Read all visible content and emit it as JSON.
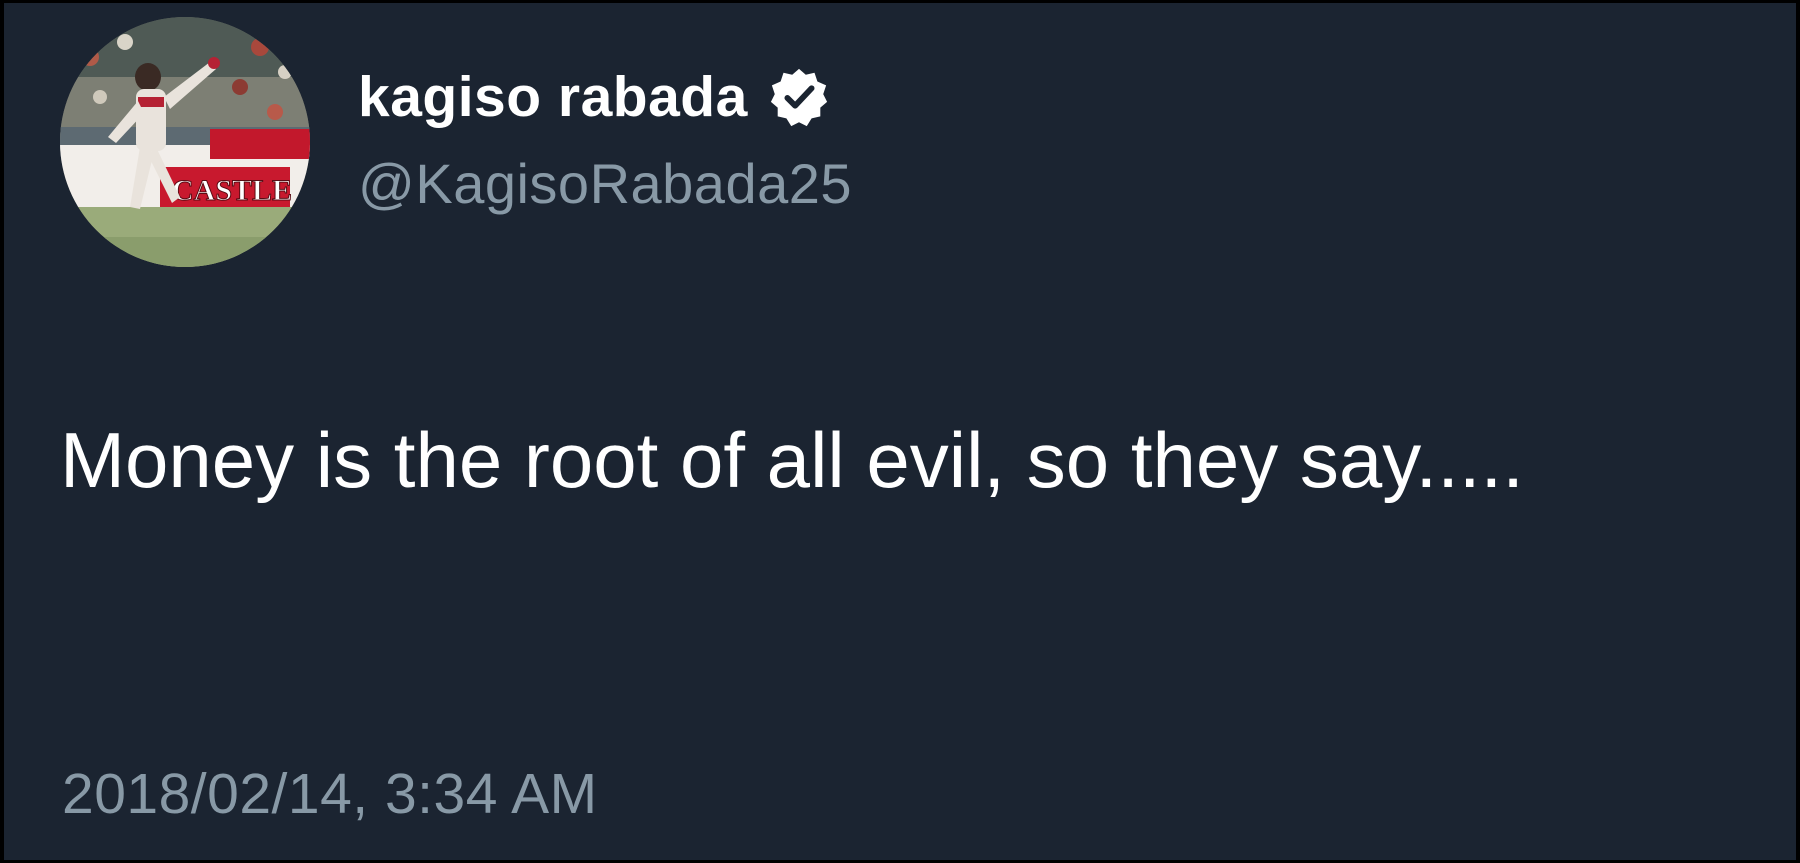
{
  "tweet": {
    "author": {
      "display_name": "kagiso rabada",
      "handle": "@KagisoRabada25",
      "verified": true,
      "avatar_icon": "profile-photo-cricket-bowler",
      "avatar_banner_text": "CASTLE"
    },
    "text": "Money is the root of all evil, so they say.....",
    "timestamp": "2018/02/14, 3:34 AM"
  },
  "colors": {
    "background": "#1b2431",
    "outer_border": "#000000",
    "primary_text": "#ffffff",
    "secondary_text": "#8899a6",
    "verified_badge": "#ffffff"
  }
}
